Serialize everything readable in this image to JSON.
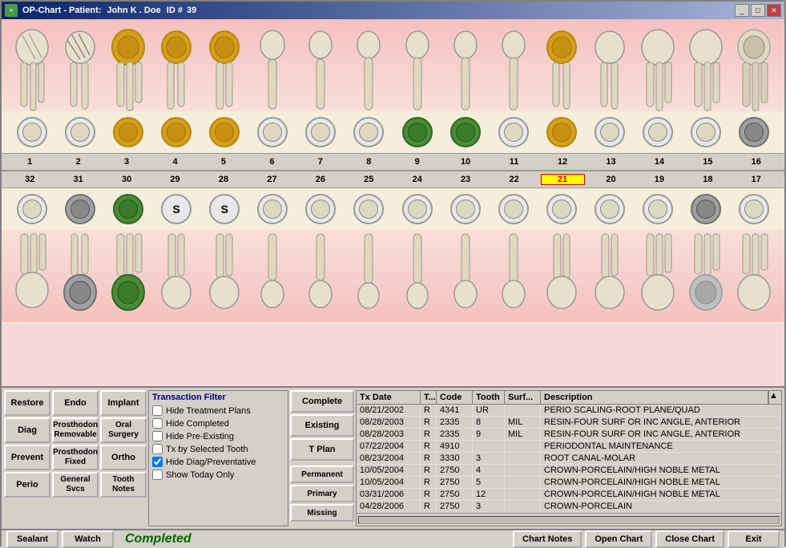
{
  "window": {
    "title": "OP-Chart - Patient:",
    "patient_name": "John K . Doe",
    "id_label": "ID #",
    "id_value": "39",
    "controls": [
      "minimize",
      "maximize",
      "close"
    ]
  },
  "upper_numbers": [
    "1",
    "2",
    "3",
    "4",
    "5",
    "6",
    "7",
    "8",
    "9",
    "10",
    "11",
    "12",
    "13",
    "14",
    "15",
    "16"
  ],
  "lower_numbers_top": [
    "32",
    "31",
    "30",
    "29",
    "28",
    "27",
    "26",
    "25",
    "24",
    "23",
    "22",
    "21",
    "20",
    "19",
    "18",
    "17"
  ],
  "lower_num_hl": "21",
  "left_buttons": [
    {
      "label": "Restore"
    },
    {
      "label": "Endo"
    },
    {
      "label": "Implant"
    },
    {
      "label": "Diag"
    },
    {
      "label": "Prosthodon\nRemovable",
      "two": true
    },
    {
      "label": "Oral Surgery",
      "two": true
    },
    {
      "label": "Prevent"
    },
    {
      "label": "Prosthodon\nFixed",
      "two": true
    },
    {
      "label": "Ortho"
    },
    {
      "label": "Perio"
    },
    {
      "label": "General\nSvcs",
      "two": true
    },
    {
      "label": "Tooth\nNotes",
      "two": true
    }
  ],
  "filter": {
    "title": "Transaction Filter",
    "items": [
      {
        "label": "Hide Treatment Plans",
        "checked": false
      },
      {
        "label": "Hide Completed",
        "checked": false
      },
      {
        "label": "Hide Pre-Existing",
        "checked": false
      },
      {
        "label": "Tx by Selected Tooth",
        "checked": false
      },
      {
        "label": "Hide Diag/Preventative",
        "checked": true
      },
      {
        "label": "Show Today Only",
        "checked": false
      }
    ]
  },
  "status_buttons": [
    "Complete",
    "Existing",
    "T Plan"
  ],
  "ppm_buttons": [
    "Permanent",
    "Primary",
    "Missing"
  ],
  "table": {
    "headers": [
      "Tx Date",
      "T...",
      "Code",
      "Tooth",
      "Surf...",
      "Description"
    ],
    "rows": [
      {
        "date": "08/21/2002",
        "t": "R",
        "code": "4341",
        "tooth": "UR",
        "surf": "",
        "desc": "PERIO SCALING-ROOT PLANE/QUAD"
      },
      {
        "date": "08/28/2003",
        "t": "R",
        "code": "2335",
        "tooth": "8",
        "surf": "MIL",
        "desc": "RESIN-FOUR SURF OR INC ANGLE, ANTERIOR"
      },
      {
        "date": "08/28/2003",
        "t": "R",
        "code": "2335",
        "tooth": "9",
        "surf": "MIL",
        "desc": "RESIN-FOUR SURF OR INC ANGLE, ANTERIOR"
      },
      {
        "date": "07/22/2004",
        "t": "R",
        "code": "4910",
        "tooth": "",
        "surf": "",
        "desc": "PERIODONTAL MAINTENANCE"
      },
      {
        "date": "08/23/2004",
        "t": "R",
        "code": "3330",
        "tooth": "3",
        "surf": "",
        "desc": "ROOT CANAL-MOLAR"
      },
      {
        "date": "10/05/2004",
        "t": "R",
        "code": "2750",
        "tooth": "4",
        "surf": "",
        "desc": "CROWN-PORCELAIN/HIGH NOBLE METAL"
      },
      {
        "date": "10/05/2004",
        "t": "R",
        "code": "2750",
        "tooth": "5",
        "surf": "",
        "desc": "CROWN-PORCELAIN/HIGH NOBLE METAL"
      },
      {
        "date": "03/31/2006",
        "t": "R",
        "code": "2750",
        "tooth": "12",
        "surf": "",
        "desc": "CROWN-PORCELAIN/HIGH NOBLE METAL"
      },
      {
        "date": "04/28/2006",
        "t": "R",
        "code": "2750",
        "tooth": "3",
        "surf": "",
        "desc": "CROWN-PORCELAIN"
      }
    ]
  },
  "bottom_bar": {
    "sealant_label": "Sealant",
    "watch_label": "Watch",
    "status_text": "Completed",
    "chart_notes_label": "Chart Notes",
    "open_chart_label": "Open Chart",
    "close_chart_label": "Close Chart",
    "exit_label": "Exit"
  },
  "tooth_styles": {
    "upper": [
      "normal",
      "striped",
      "gold-crown",
      "gold-crown",
      "normal",
      "normal",
      "normal",
      "normal",
      "normal",
      "normal",
      "normal",
      "gold-only",
      "normal",
      "normal",
      "normal",
      "normal"
    ],
    "lower_top": [
      "normal",
      "gray",
      "green",
      "s",
      "s",
      "normal",
      "normal",
      "normal",
      "normal",
      "normal",
      "normal",
      "normal",
      "normal",
      "normal",
      "normal",
      "normal"
    ],
    "upper_occlusal": [
      "white",
      "white",
      "gold",
      "gold",
      "gold",
      "white",
      "white",
      "white",
      "green",
      "green",
      "white",
      "gold",
      "white",
      "white",
      "white",
      "gray"
    ],
    "lower_occlusal": [
      "white",
      "gray",
      "green",
      "s",
      "s",
      "white",
      "white",
      "white",
      "white",
      "white",
      "white",
      "white",
      "white",
      "white",
      "gray",
      "white"
    ]
  }
}
